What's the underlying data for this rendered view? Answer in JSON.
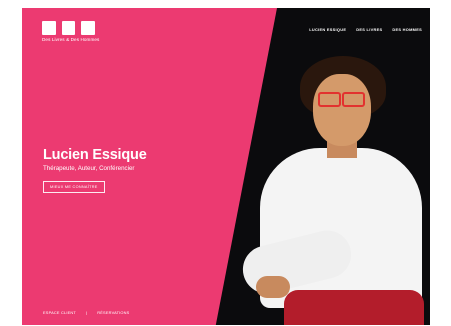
{
  "logo": {
    "text": "Des Livres & Des Hommes"
  },
  "nav": {
    "items": [
      "LUCIEN ESSIQUE",
      "DES LIVRES",
      "DES HOMMES"
    ]
  },
  "hero": {
    "title": "Lucien Essique",
    "subtitle": "Thérapeute, Auteur, Conférencier",
    "cta": "MIEUX ME CONNAÎTRE"
  },
  "footer": {
    "items": [
      "ESPACE CLIENT",
      "|",
      "RÉSERVATIONS"
    ]
  },
  "colors": {
    "accent": "#ec3a71",
    "dark": "#0b0b0d"
  }
}
